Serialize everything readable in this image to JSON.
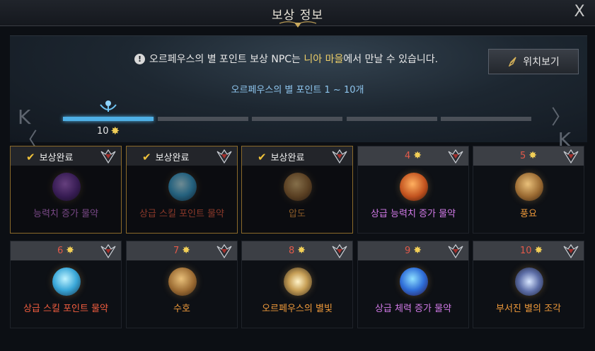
{
  "window": {
    "title": "보상 정보",
    "close_glyph": "X"
  },
  "notice": {
    "text_before": "오르페우스의 별 포인트 보상 NPC는 ",
    "highlight": "니아 마을",
    "text_after": "에서 만날 수 있습니다."
  },
  "location_button": {
    "label": "위치보기",
    "icon": "compass-needle-icon"
  },
  "range_label": "오르페우스의 별 포인트 1 ~ 10개",
  "progress": {
    "current_points": "10",
    "active_segment": 1,
    "segments": 5,
    "prev_glyph": "K〈",
    "next_glyph": "〉K"
  },
  "colors": {
    "accent_blue": "#4fb0e6",
    "star_gold": "#f2cf57",
    "completed_check": "#f0c23a"
  },
  "rewards": [
    {
      "status": "보상완료",
      "completed": true,
      "name": "능력치 증가 물약",
      "icon": "purple-potion-icon",
      "color": "purple"
    },
    {
      "status": "보상완료",
      "completed": true,
      "name": "상급 스킬 포인트 물약",
      "icon": "blue-flask-icon",
      "color": "red"
    },
    {
      "status": "보상완료",
      "completed": true,
      "name": "압도",
      "icon": "rune-stone-icon",
      "color": "orange"
    },
    {
      "points": "4",
      "completed": false,
      "name": "상급 능력치 증가 물약",
      "icon": "orange-potion-icon",
      "color": "purple"
    },
    {
      "points": "5",
      "completed": false,
      "name": "풍요",
      "icon": "rune-stone-icon",
      "color": "orange"
    },
    {
      "points": "6",
      "completed": false,
      "name": "상급 스킬 포인트 물약",
      "icon": "blue-flask-icon",
      "color": "red"
    },
    {
      "points": "7",
      "completed": false,
      "name": "수호",
      "icon": "rune-stone-icon",
      "color": "orange"
    },
    {
      "points": "8",
      "completed": false,
      "name": "오르페우스의 별빛",
      "icon": "star-orb-icon",
      "color": "orange"
    },
    {
      "points": "9",
      "completed": false,
      "name": "상급 체력 증가 물약",
      "icon": "blue-potion-icon",
      "color": "purple"
    },
    {
      "points": "10",
      "completed": false,
      "name": "부서진 별의 조각",
      "icon": "star-shard-icon",
      "color": "orange"
    }
  ]
}
